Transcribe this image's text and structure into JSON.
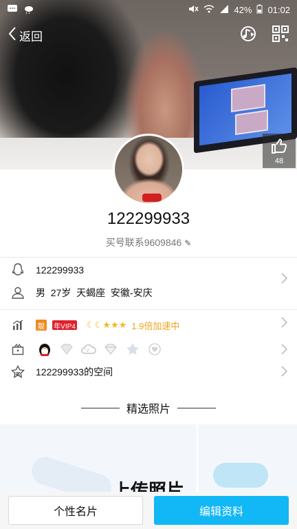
{
  "status_bar": {
    "battery": "42%",
    "time": "01:02"
  },
  "nav": {
    "back_label": "返回"
  },
  "cover": {
    "like_count": "48"
  },
  "profile": {
    "nickname": "122299933",
    "signature": "买号联系9609846"
  },
  "info": {
    "qq_number": "122299933",
    "details": "男  27岁  天蝎座  安徽-安庆",
    "level_badge": "靓",
    "vip_badge": "年VIP4",
    "level_icons": "☾☾★★★",
    "speed_text": "1.9倍加速中",
    "space_label": "122299933的空间"
  },
  "photos": {
    "section_title": "精选照片",
    "upload_label": "上传照片"
  },
  "actions": {
    "card_label": "个性名片",
    "edit_label": "编辑资料"
  },
  "colors": {
    "primary": "#12b7f5",
    "speed_text": "#f0a41a",
    "vip_red": "#e0202c",
    "level_orange": "#f08a1e"
  }
}
